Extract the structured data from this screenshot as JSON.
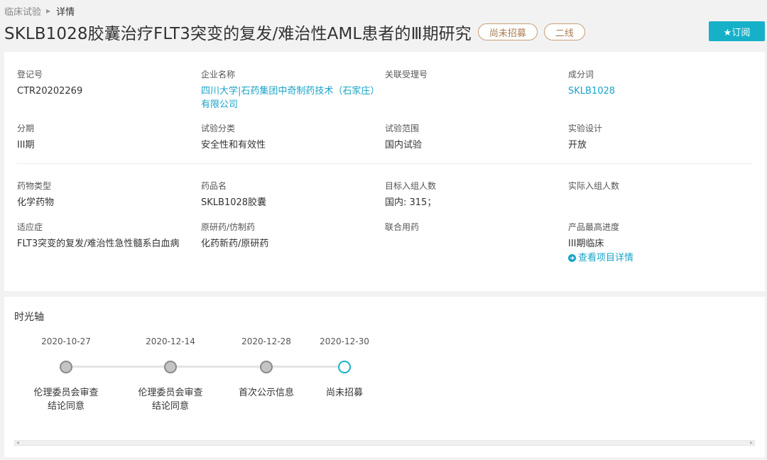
{
  "breadcrumb": {
    "parent": "临床试验",
    "current": "详情"
  },
  "header": {
    "title": "SKLB1028胶囊治疗FLT3突变的复发/难治性AML患者的Ⅲ期研究",
    "status_badge": "尚未招募",
    "line_badge": "二线",
    "subscribe_label": "★订阅"
  },
  "info": {
    "reg_no": {
      "label": "登记号",
      "value": "CTR20202269"
    },
    "company": {
      "label": "企业名称",
      "value_line1": "四川大学|石药集团中奇制药技术（石家庄）",
      "value_line2": "有限公司"
    },
    "related_no": {
      "label": "关联受理号",
      "value": ""
    },
    "ingredient": {
      "label": "成分词",
      "value": "SKLB1028"
    },
    "phase": {
      "label": "分期",
      "value": "III期"
    },
    "category": {
      "label": "试验分类",
      "value": "安全性和有效性"
    },
    "scope": {
      "label": "试验范围",
      "value": "国内试验"
    },
    "design": {
      "label": "实验设计",
      "value": "开放"
    },
    "drug_type": {
      "label": "药物类型",
      "value": "化学药物"
    },
    "drug_name": {
      "label": "药品名",
      "value": "SKLB1028胶囊"
    },
    "target_enroll": {
      "label": "目标入组人数",
      "value": "国内: 315；"
    },
    "actual_enroll": {
      "label": "实际入组人数",
      "value": ""
    },
    "indication": {
      "label": "适应症",
      "value": "FLT3突变的复发/难治性急性髓系白血病"
    },
    "original_generic": {
      "label": "原研药/仿制药",
      "value": "化药新药/原研药"
    },
    "combination": {
      "label": "联合用药",
      "value": ""
    },
    "highest_progress": {
      "label": "产品最高进度",
      "value": "III期临床",
      "link": "查看项目详情"
    }
  },
  "timeline": {
    "title": "时光轴",
    "events": [
      {
        "date": "2020-10-27",
        "label_line1": "伦理委员会审查",
        "label_line2": "结论同意"
      },
      {
        "date": "2020-12-14",
        "label_line1": "伦理委员会审查",
        "label_line2": "结论同意"
      },
      {
        "date": "2020-12-28",
        "label_line1": "首次公示信息",
        "label_line2": ""
      },
      {
        "date": "2020-12-30",
        "label_line1": "尚未招募",
        "label_line2": ""
      }
    ]
  },
  "icons": {
    "breadcrumb_separator": "triangle-right-icon",
    "subscribe": "star-icon",
    "detail_link": "arrow-circle-right-icon",
    "scroll_left": "triangle-left-icon",
    "scroll_right": "triangle-right-icon"
  },
  "colors": {
    "accent": "#16b1c9",
    "link": "#1aa3c8",
    "badge_border": "#c8a078",
    "badge_text": "#a97c50",
    "page_bg": "#f2f2f2"
  }
}
